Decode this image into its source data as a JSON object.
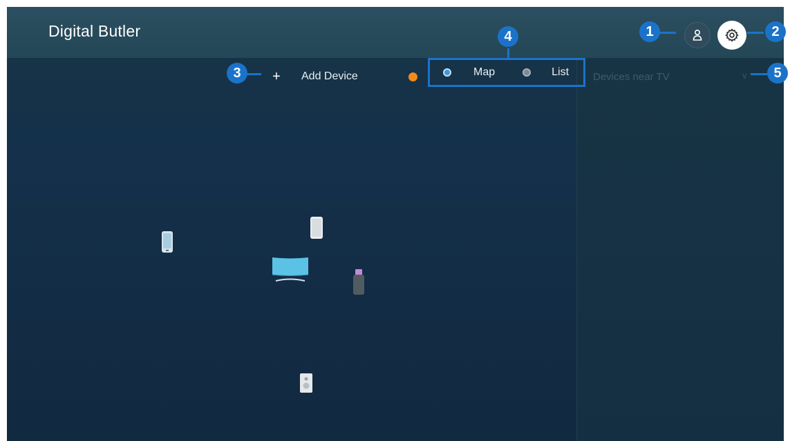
{
  "header": {
    "title": "Digital Butler"
  },
  "toolbar": {
    "add_icon": "+",
    "add_label": "Add Device",
    "view_options": [
      {
        "label": "Map",
        "selected": true
      },
      {
        "label": "List",
        "selected": false
      }
    ],
    "filter_placeholder": "Devices near TV"
  },
  "callouts": [
    "1",
    "2",
    "3",
    "4",
    "5"
  ],
  "devices": [
    {
      "icon": "smartphone-icon"
    },
    {
      "icon": "tablet-icon"
    },
    {
      "icon": "tv-icon"
    },
    {
      "icon": "usb-stick-icon"
    },
    {
      "icon": "speaker-icon"
    }
  ],
  "colors": {
    "accent": "#1b73c9",
    "notification_dot": "#f28a1d",
    "selected_radio": "#3b98e0",
    "background": "#14304a"
  }
}
